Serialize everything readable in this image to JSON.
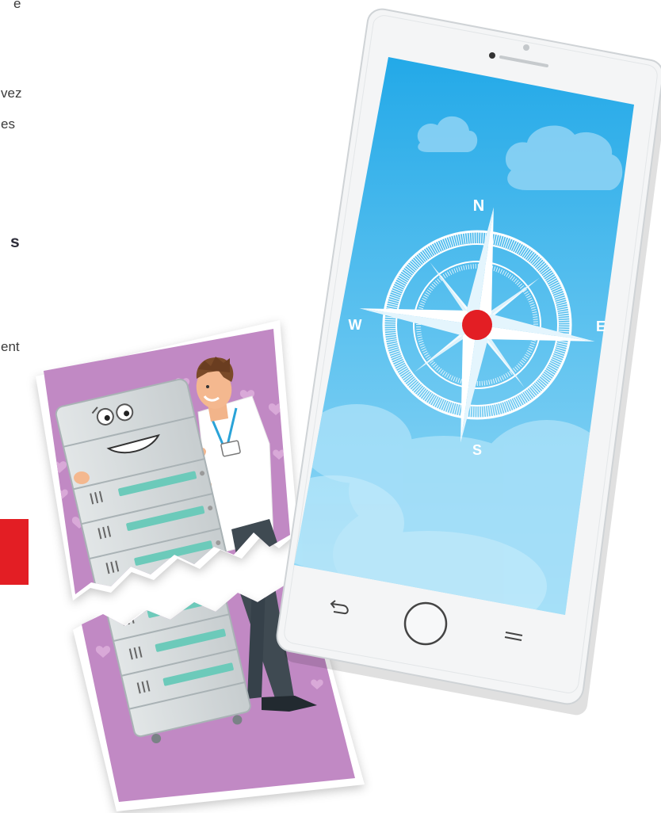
{
  "text_fragments": [
    "e",
    "vez",
    "es",
    "s",
    "ent"
  ],
  "compass": {
    "north": "N",
    "south": "S",
    "east": "E",
    "west": "W"
  },
  "icons": {
    "back": "back-arrow-icon",
    "home": "home-button-icon",
    "menu": "menu-lines-icon"
  },
  "colors": {
    "accent_red": "#e31e24",
    "screen_top": "#2bb0ea",
    "screen_bottom": "#8fd8f6",
    "photo_bg": "#c189c4",
    "server_body": "#d6dbdc",
    "server_slot": "#6ccaba"
  }
}
